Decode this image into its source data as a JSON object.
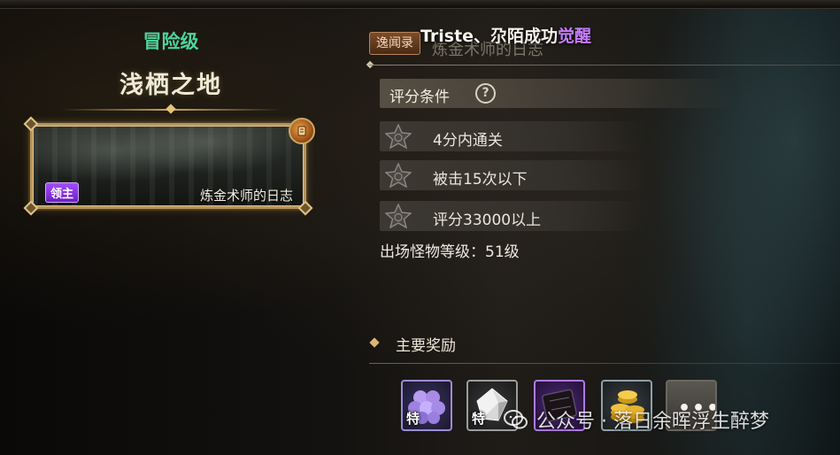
{
  "left_panel": {
    "difficulty": "冒险级",
    "stage_title": "浅栖之地",
    "card": {
      "boss_tag": "领主",
      "caption": "炼金术师的日志"
    }
  },
  "right_panel": {
    "dungeon_tag": "逸闻录",
    "notice": {
      "player": "Triste、尕陌成功",
      "highlight": "觉醒"
    },
    "dungeon_name": "炼金术师的日志",
    "score_conditions": {
      "header": "评分条件",
      "help_symbol": "?",
      "items": [
        {
          "text": "4分内通关"
        },
        {
          "text": "被击15次以下"
        },
        {
          "text": "评分33000以上"
        }
      ]
    },
    "monster_level": "出场怪物等级：51级",
    "rewards": {
      "title": "主要奖励",
      "items": [
        {
          "icon": "purple-orb-cluster-icon",
          "tag": "特"
        },
        {
          "icon": "crystal-shard-icon",
          "tag": "特"
        },
        {
          "icon": "dark-card-icon",
          "tag": ""
        },
        {
          "icon": "gold-coins-icon",
          "tag": ""
        },
        {
          "icon": "more-icon",
          "tag": "•••"
        }
      ]
    }
  },
  "watermark": {
    "text": "公众号 · 落日余晖浮生醉梦"
  },
  "colors": {
    "difficulty": "#4fd39b",
    "awaken": "#c77dff",
    "boss_tag": "#8a35e8",
    "frame_gold": "#b8955a"
  }
}
